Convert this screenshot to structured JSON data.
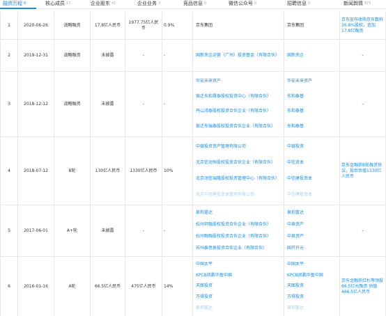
{
  "tabs": [
    {
      "label": "融资历程",
      "count": "6",
      "active": true
    },
    {
      "label": "核心成员",
      "count": "17",
      "active": false
    },
    {
      "label": "企业股东",
      "count": "41",
      "active": false
    },
    {
      "label": "企业业务",
      "count": "3",
      "active": false
    },
    {
      "label": "竞品信息",
      "count": "0",
      "active": false
    },
    {
      "label": "微信公众号",
      "count": "0",
      "active": false
    },
    {
      "label": "招聘信息",
      "count": "0",
      "active": false
    },
    {
      "label": "新闻舆情",
      "count": "875",
      "active": false
    }
  ],
  "rows": [
    {
      "index": "1",
      "date": "2020-06-26",
      "round": "战略融资",
      "amount": "17.8亿人民币",
      "valuation": "1977.75亿人民币",
      "ratio": "0.9%",
      "investors": [
        "京东集团"
      ],
      "investors2": [
        "京东集团"
      ],
      "news": "京东宣布收购京东数科36.8%股权，追加17.8亿融资"
    },
    {
      "index": "2",
      "date": "2019-12-31",
      "round": "战略融资",
      "amount": "未披露",
      "valuation": "-",
      "ratio": "-",
      "investors": [
        "国新央企运营（广州）投资基金（有限合伙）"
      ],
      "investors2": [
        "国新央企"
      ],
      "news": "-"
    },
    {
      "index": "3",
      "date": "2018-12-12",
      "round": "战略融资",
      "amount": "未披露",
      "valuation": "-",
      "ratio": "-",
      "investors": [
        "华安未来资产",
        "宿迁东和晟泰股权投资中心（有限合伙）",
        "丹山湾泰股权投资合伙企业（有限合伙）",
        "宿迁东瑞泰股权投资合伙企业（有限合伙）"
      ],
      "investors2": [
        "华安未来资产",
        "东和泰基",
        "东和泰基",
        "东和泰基"
      ],
      "news": "-"
    },
    {
      "index": "4",
      "date": "2018-07-12",
      "round": "B轮",
      "amount": "130亿人民币",
      "valuation": "1330亿人民币",
      "ratio": "10%",
      "investors": [
        "中银投资资产管理有限公司",
        "北京信润恒股权投资合伙企业（有限合伙）",
        "北京润信瑞隆股权投资管理中心（有限合伙）",
        "北京中信建投资本管理有限公司"
      ],
      "investors2": [
        "中银投资",
        "中信资本",
        "中信建投资本",
        "中信建投资本"
      ],
      "news": "京东金融获B轮融资协议，投后估值1330亿人民币"
    },
    {
      "index": "5",
      "date": "2017-06-01",
      "round": "A+轮",
      "amount": "未披露",
      "valuation": "-",
      "ratio": "-",
      "investors": [
        "泉和篁达",
        "杭州轩融股权投资合伙企业（有限合伙）",
        "杭州融融股权投资合伙企业（有限合伙）",
        "苏州泰思敦投资合伙企业（有限合伙）"
      ],
      "investors2": [
        "泉和篁达",
        "中泉资产",
        "中泉资产",
        "国开开元"
      ],
      "news": "-"
    },
    {
      "index": "6",
      "date": "2016-01-16",
      "round": "A轮",
      "amount": "66.5亿人民币",
      "valuation": "475亿人民币",
      "ratio": "14%",
      "investors": [
        "中国太平",
        "KPCB凯鹏华盈中国",
        "天图投资",
        "万得投资",
        "泉和篁达"
      ],
      "investors2": [
        "中国太平",
        "KPCB凯鹏华盈中国",
        "天图投资",
        "万得投资",
        "泉和篁达"
      ],
      "news": "京东金融获红杉等领投66.5亿元融资 估值466.5亿人民币"
    }
  ]
}
